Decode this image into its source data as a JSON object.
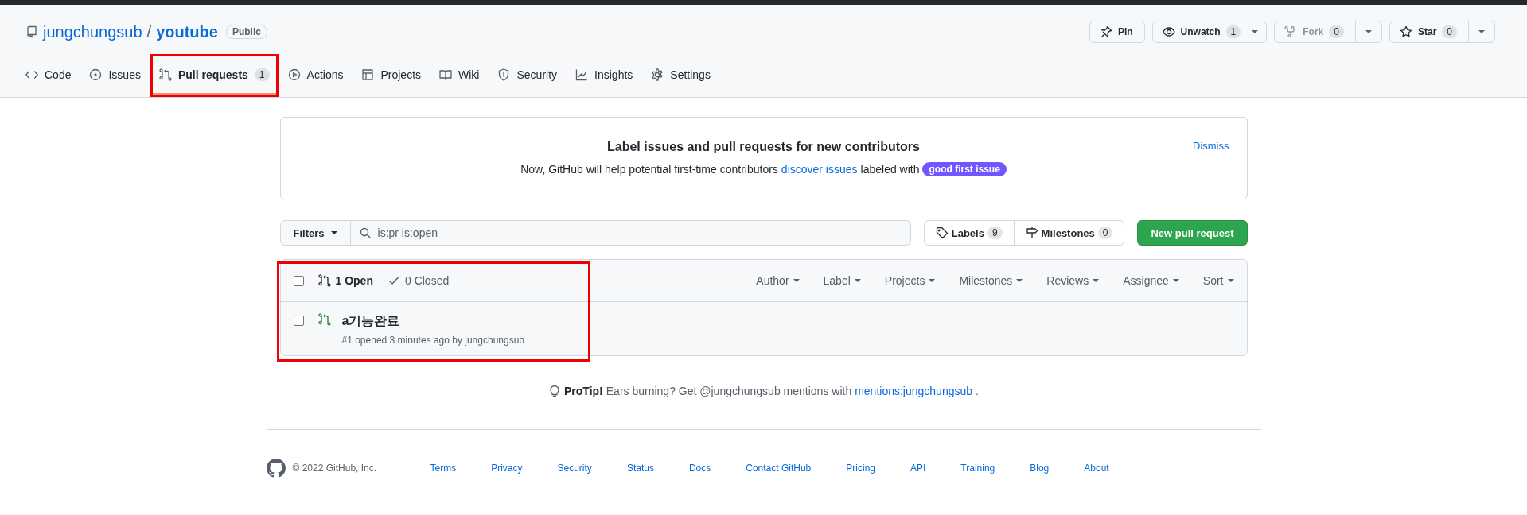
{
  "repo": {
    "owner": "jungchungsub",
    "separator": "/",
    "name": "youtube",
    "visibility": "Public"
  },
  "repo_actions": [
    {
      "kind": "pin",
      "label": "Pin",
      "disabled": false
    },
    {
      "kind": "watch",
      "label": "Unwatch",
      "count": "1",
      "disabled": false
    },
    {
      "kind": "fork",
      "label": "Fork",
      "count": "0",
      "disabled": true
    },
    {
      "kind": "star",
      "label": "Star",
      "count": "0",
      "disabled": false
    }
  ],
  "tabs": [
    {
      "kind": "code",
      "label": "Code",
      "selected": false,
      "highlighted": false
    },
    {
      "kind": "issues",
      "label": "Issues",
      "selected": false,
      "highlighted": false
    },
    {
      "kind": "pull",
      "label": "Pull requests",
      "count": "1",
      "selected": true,
      "highlighted": true
    },
    {
      "kind": "actions",
      "label": "Actions",
      "selected": false,
      "highlighted": false
    },
    {
      "kind": "projects",
      "label": "Projects",
      "selected": false,
      "highlighted": false
    },
    {
      "kind": "wiki",
      "label": "Wiki",
      "selected": false,
      "highlighted": false
    },
    {
      "kind": "security",
      "label": "Security",
      "selected": false,
      "highlighted": false
    },
    {
      "kind": "insights",
      "label": "Insights",
      "selected": false,
      "highlighted": false
    },
    {
      "kind": "settings",
      "label": "Settings",
      "selected": false,
      "highlighted": false
    }
  ],
  "banner": {
    "title": "Label issues and pull requests for new contributors",
    "text": "Now, GitHub will help potential first-time contributors",
    "link": "discover issues",
    "text_after": "labeled with",
    "label": "good first issue",
    "dismiss": "Dismiss"
  },
  "filters": {
    "button": "Filters",
    "search_value": "is:pr is:open",
    "labels": {
      "label": "Labels",
      "count": "9"
    },
    "milestones": {
      "label": "Milestones",
      "count": "0"
    },
    "new_button": "New pull request"
  },
  "pull_list": {
    "highlighted": true,
    "checked": false,
    "states": [
      {
        "kind": "open",
        "label": "1 Open",
        "selected": true
      },
      {
        "kind": "closed",
        "label": "0 Closed",
        "selected": false
      }
    ],
    "menus": [
      "Author",
      "Label",
      "Projects",
      "Milestones",
      "Reviews",
      "Assignee",
      "Sort"
    ],
    "items": [
      {
        "title": "a기능완료",
        "meta": "#1 opened 3 minutes ago by jungchungsub",
        "checked": false
      }
    ]
  },
  "protip": {
    "lead": "ProTip!",
    "text": "Ears burning? Get @jungchungsub mentions with",
    "link": "mentions:jungchungsub",
    "end": "."
  },
  "footer": {
    "copyright": "© 2022 GitHub, Inc.",
    "links": [
      "Terms",
      "Privacy",
      "Security",
      "Status",
      "Docs",
      "Contact GitHub",
      "Pricing",
      "API",
      "Training",
      "Blog",
      "About"
    ]
  }
}
